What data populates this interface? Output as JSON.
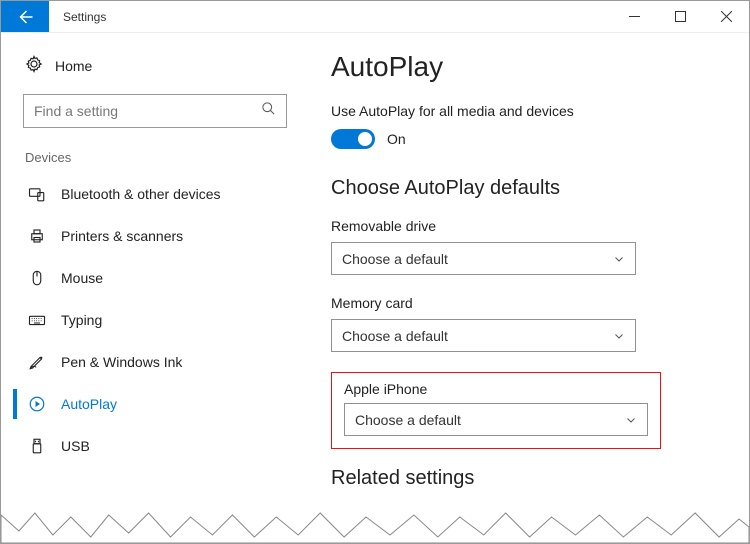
{
  "window": {
    "title": "Settings"
  },
  "sidebar": {
    "home": "Home",
    "search_placeholder": "Find a setting",
    "section": "Devices",
    "items": [
      {
        "label": "Bluetooth & other devices"
      },
      {
        "label": "Printers & scanners"
      },
      {
        "label": "Mouse"
      },
      {
        "label": "Typing"
      },
      {
        "label": "Pen & Windows Ink"
      },
      {
        "label": "AutoPlay"
      },
      {
        "label": "USB"
      }
    ]
  },
  "main": {
    "heading": "AutoPlay",
    "toggle_desc": "Use AutoPlay for all media and devices",
    "toggle_label": "On",
    "defaults_heading": "Choose AutoPlay defaults",
    "fields": [
      {
        "label": "Removable drive",
        "value": "Choose a default"
      },
      {
        "label": "Memory card",
        "value": "Choose a default"
      },
      {
        "label": "Apple iPhone",
        "value": "Choose a default"
      }
    ],
    "related_heading": "Related settings"
  }
}
